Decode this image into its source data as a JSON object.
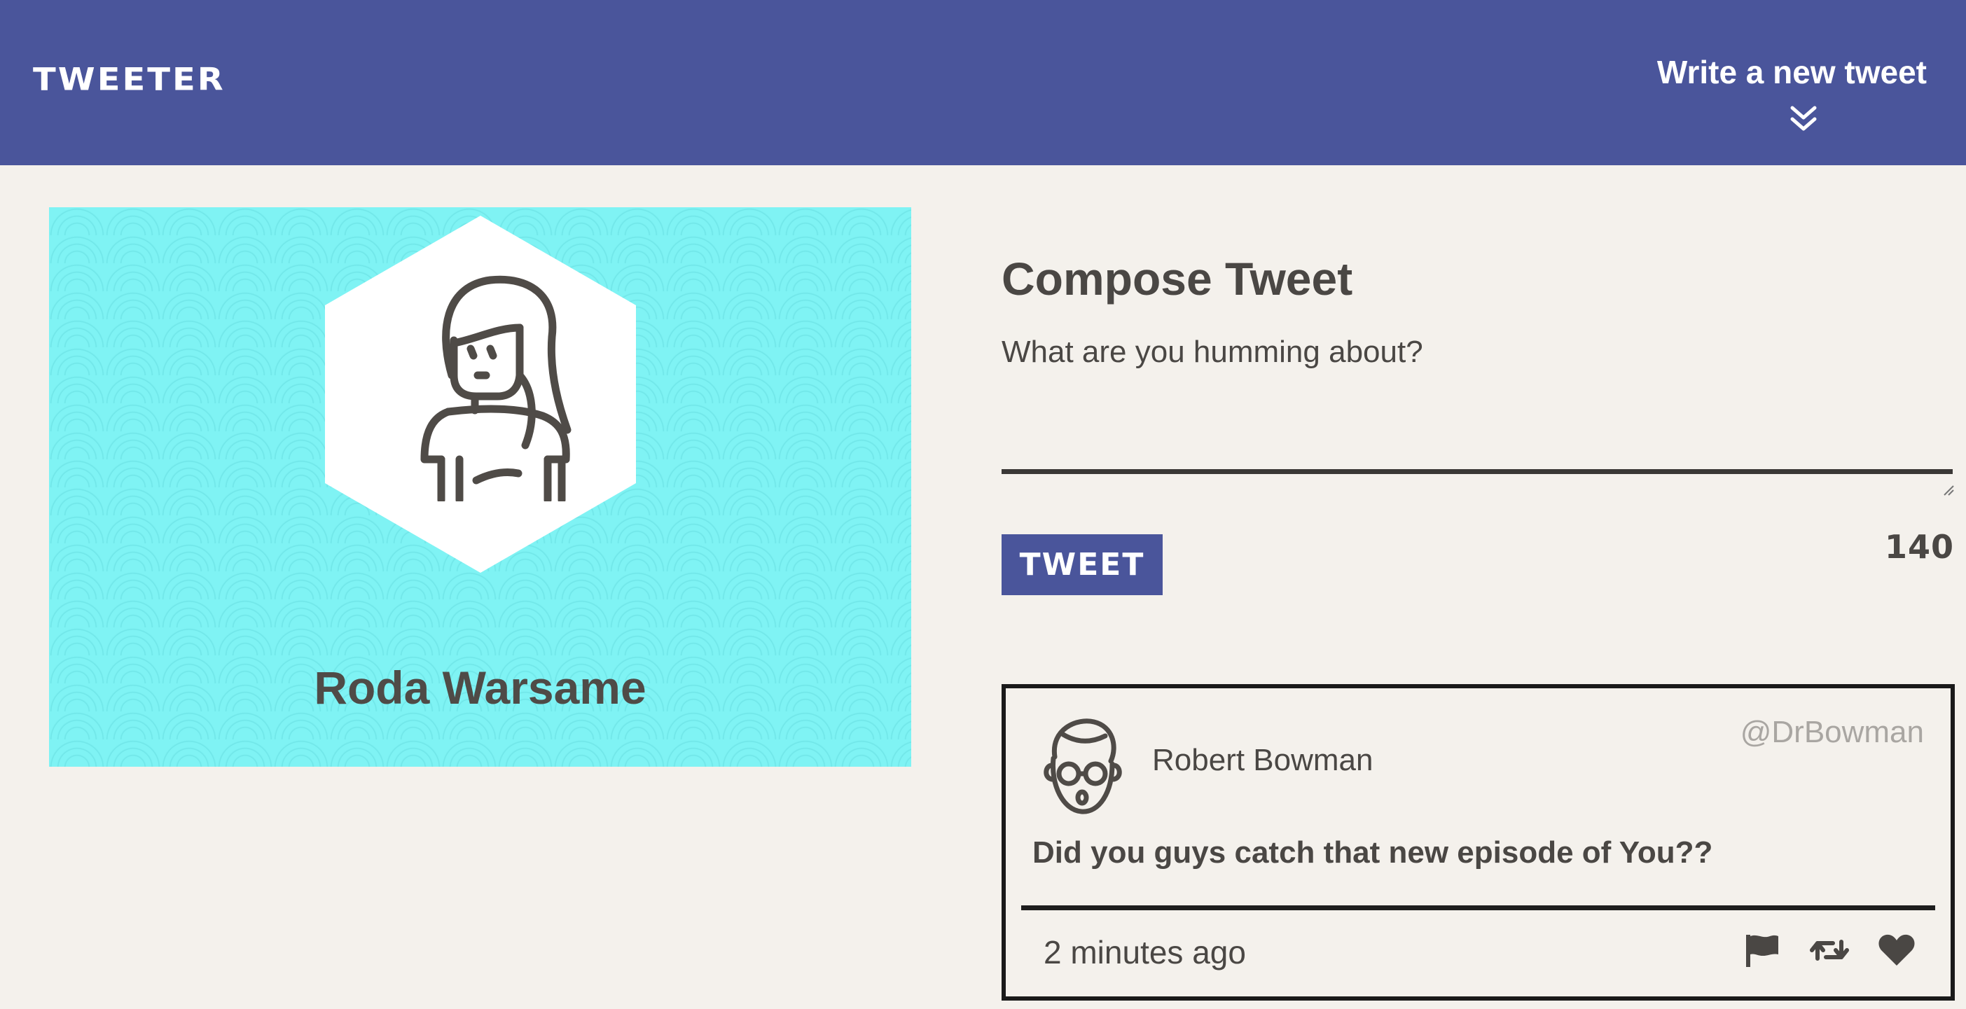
{
  "nav": {
    "brand": "TWEETER",
    "compose_toggle_label": "Write a new tweet",
    "compose_toggle_icon": "double-chevron-down-icon",
    "background_color": "#4a559b"
  },
  "profile": {
    "name": "Roda Warsame",
    "avatar_icon": "woman-avatar-icon",
    "background_color": "#7ff3f4"
  },
  "compose": {
    "title": "Compose Tweet",
    "placeholder": "What are you humming about?",
    "value": "",
    "submit_label": "TWEET",
    "char_counter": "140"
  },
  "tweets": [
    {
      "author_name": "Robert Bowman",
      "handle": "@DrBowman",
      "avatar_icon": "man-glasses-avatar-icon",
      "content": "Did you guys catch that new episode of You??",
      "timestamp": "2 minutes ago",
      "actions": [
        "flag-icon",
        "retweet-icon",
        "heart-icon"
      ]
    }
  ]
}
